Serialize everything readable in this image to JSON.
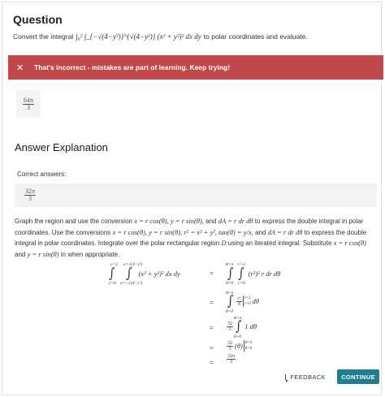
{
  "question": {
    "title": "Question",
    "prompt_prefix": "Convert the integral",
    "integral_expr": "∫₀² ∫_{−√(4−y²)}^{√(4−y²)} (x² + y²)² dx dy",
    "prompt_suffix": "to polar coordinates and evaluate."
  },
  "banner": {
    "icon": "close-icon",
    "message": "That's incorrect - mistakes are part of learning. Keep trying!",
    "color": "#c0474a"
  },
  "user_answer": {
    "num": "64π",
    "den": "3"
  },
  "explanation": {
    "title": "Answer Explanation",
    "correct_label": "Correct answers:",
    "correct_answer": {
      "num": "32π",
      "den": "3"
    },
    "text": {
      "p1": "Graph the region and use the conversion",
      "m1": "x = r cos(θ), y = r sin(θ),",
      "p2": "and",
      "m2": "dA = r dr dθ",
      "p3": "to express the double integral in polar coordinates. Use the conversions",
      "m3": "x = r cos(θ), y = r sin(θ), r² = x² + y², tan(θ) = y/x,",
      "p4": "and",
      "m4": "dA = r dr dθ",
      "p5": "to express the double integral in polar coordinates. Integrate over the polar rectangular region",
      "m5": "D",
      "p6": "using an iterated integral. Substitute",
      "m6": "x = r cos(θ)",
      "p7": "and",
      "m7": "y = r sin(θ)",
      "p8": "in when appropriate."
    },
    "derivation": {
      "lhs": "(x² + y²)² dx dy",
      "lhs_outer_upper": "y=2",
      "lhs_outer_lower": "y=0",
      "lhs_inner_upper": "x=√(4−y²)",
      "lhs_inner_lower": "x=−√(4−y²)",
      "step1": "(r²)² r dr dθ",
      "step1_outer_upper": "θ=π",
      "step1_outer_lower": "θ=0",
      "step1_inner_upper": "r=2",
      "step1_inner_lower": "r=0",
      "step2_num": "r⁶",
      "step2_den": "6",
      "step2_eval_upper": "r=2",
      "step2_eval_lower": "r=0",
      "step2_tail": "dθ",
      "step2_upper": "θ=π",
      "step2_lower": "θ=0",
      "step3_num": "32",
      "step3_den": "3",
      "step3_tail": "1 dθ",
      "step3_upper": "θ=π",
      "step3_lower": "θ=0",
      "step4_num": "32",
      "step4_den": "3",
      "step4_mid": "(θ)",
      "step4_upper": "θ=π",
      "step4_lower": "θ=0",
      "result_num": "32π",
      "result_den": "3",
      "eq": "="
    }
  },
  "footer": {
    "feedback_label": "FEEDBACK",
    "feedback_icon": "feedback-icon",
    "continue_label": "CONTINUE",
    "accent": "#1f7f8f"
  }
}
